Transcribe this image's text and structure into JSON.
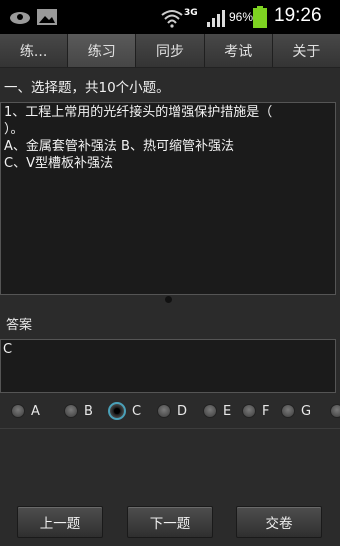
{
  "status_bar": {
    "network": "3G",
    "battery": "96%",
    "time": "19:26"
  },
  "tabs": [
    {
      "label": "练...",
      "active": false
    },
    {
      "label": "练习",
      "active": true
    },
    {
      "label": "同步",
      "active": false
    },
    {
      "label": "考试",
      "active": false
    },
    {
      "label": "关于",
      "active": false
    }
  ],
  "section_title": "一、选择题，共10个小题。",
  "question": {
    "text": "1、工程上常用的光纤接头的增强保护措施是（\n）。\nA、金属套管补强法 B、热可缩管补强法\nC、V型槽板补强法"
  },
  "answer": {
    "title": "答案",
    "value": "C"
  },
  "options": [
    {
      "label": "A",
      "checked": false
    },
    {
      "label": "B",
      "checked": false
    },
    {
      "label": "C",
      "checked": true
    },
    {
      "label": "D",
      "checked": false
    },
    {
      "label": "E",
      "checked": false
    },
    {
      "label": "F",
      "checked": false
    },
    {
      "label": "G",
      "checked": false
    }
  ],
  "buttons": {
    "prev": "上一题",
    "next": "下一题",
    "submit": "交卷"
  },
  "colors": {
    "background": "#2b2b2b",
    "box": "#1b1b1b",
    "selected_ring": "#4aa0b8",
    "battery": "#7ed321"
  }
}
